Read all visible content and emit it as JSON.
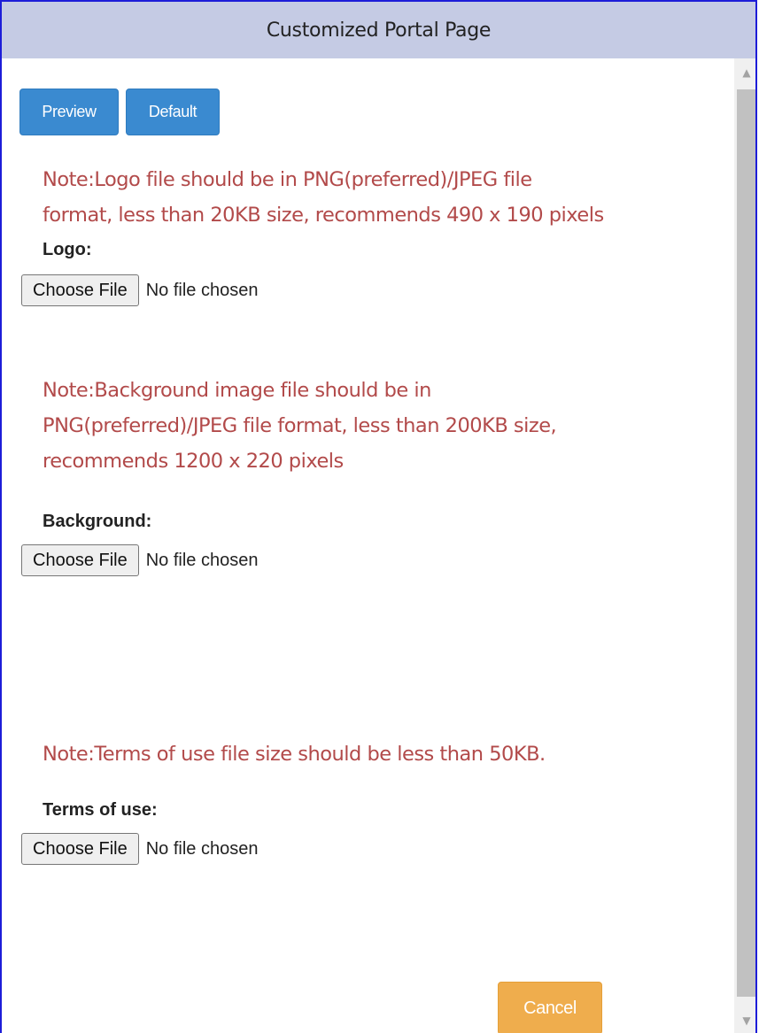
{
  "dialog": {
    "title": "Customized Portal Page"
  },
  "toolbar": {
    "preview_label": "Preview",
    "default_label": "Default"
  },
  "logo": {
    "note_line1": "Note:Logo file should be in PNG(preferred)/JPEG file",
    "note_line2": "format, less than 20KB size, recommends 490 x 190 pixels",
    "label": "Logo:",
    "choose_label": "Choose File",
    "status": "No file chosen"
  },
  "background": {
    "note_line1": "Note:Background image file should be in",
    "note_line2": "PNG(preferred)/JPEG file format, less than 200KB size,",
    "note_line3": "recommends 1200 x 220 pixels",
    "label": "Background:",
    "choose_label": "Choose File",
    "status": "No file chosen"
  },
  "terms": {
    "note": "Note:Terms of use file size should be less than 50KB.",
    "label": "Terms of use:",
    "choose_label": "Choose File",
    "status": "No file chosen"
  },
  "footer": {
    "cancel_label": "Cancel"
  },
  "colors": {
    "title_bar": "#c5cbe4",
    "primary_button": "#3a8ad0",
    "cancel_button": "#efad4d",
    "note_text": "#b24a4a",
    "border": "#1d1dd8"
  },
  "icons": {
    "scroll_up": "triangle-up-icon",
    "scroll_down": "triangle-down-icon"
  }
}
